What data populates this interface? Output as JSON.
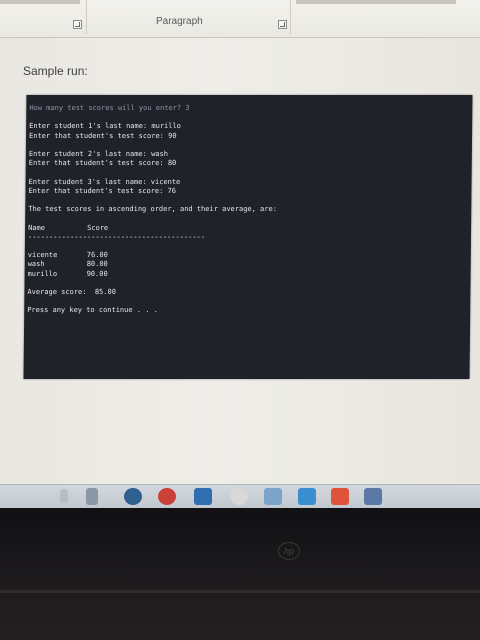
{
  "ribbon": {
    "group_label": "Paragraph"
  },
  "document": {
    "sample_label": "Sample run:"
  },
  "console": {
    "lines": [
      "How many test scores will you enter? 3",
      "",
      "Enter student 1's last name: murillo",
      "Enter that student's test score: 90",
      "",
      "Enter student 2's last name: wash",
      "Enter that student's test score: 80",
      "",
      "Enter student 3's last name: vicente",
      "Enter that student's test score: 76",
      "",
      "The test scores in ascending order, and their average, are:",
      "",
      "Name          Score",
      "------------------------------------------",
      "",
      "vicente       76.00",
      "wash          80.00",
      "murillo       90.00",
      "",
      "Average score:  85.00",
      "",
      "Press any key to continue . . ."
    ]
  },
  "taskbar": {
    "icons": [
      {
        "name": "media-player-icon",
        "color": "#2f5f8f"
      },
      {
        "name": "chrome-icon",
        "color": "#c9413a"
      },
      {
        "name": "file-explorer-icon",
        "color": "#2f6fb1"
      },
      {
        "name": "browser-icon",
        "color": "#d8d8d8"
      },
      {
        "name": "photos-icon",
        "color": "#7aa4c9"
      },
      {
        "name": "app-icon",
        "color": "#3a8fd1"
      },
      {
        "name": "windows-store-icon",
        "color": "#e0533b"
      },
      {
        "name": "paint-icon",
        "color": "#5a79a6"
      }
    ]
  },
  "bezel": {
    "logo": "hp"
  }
}
